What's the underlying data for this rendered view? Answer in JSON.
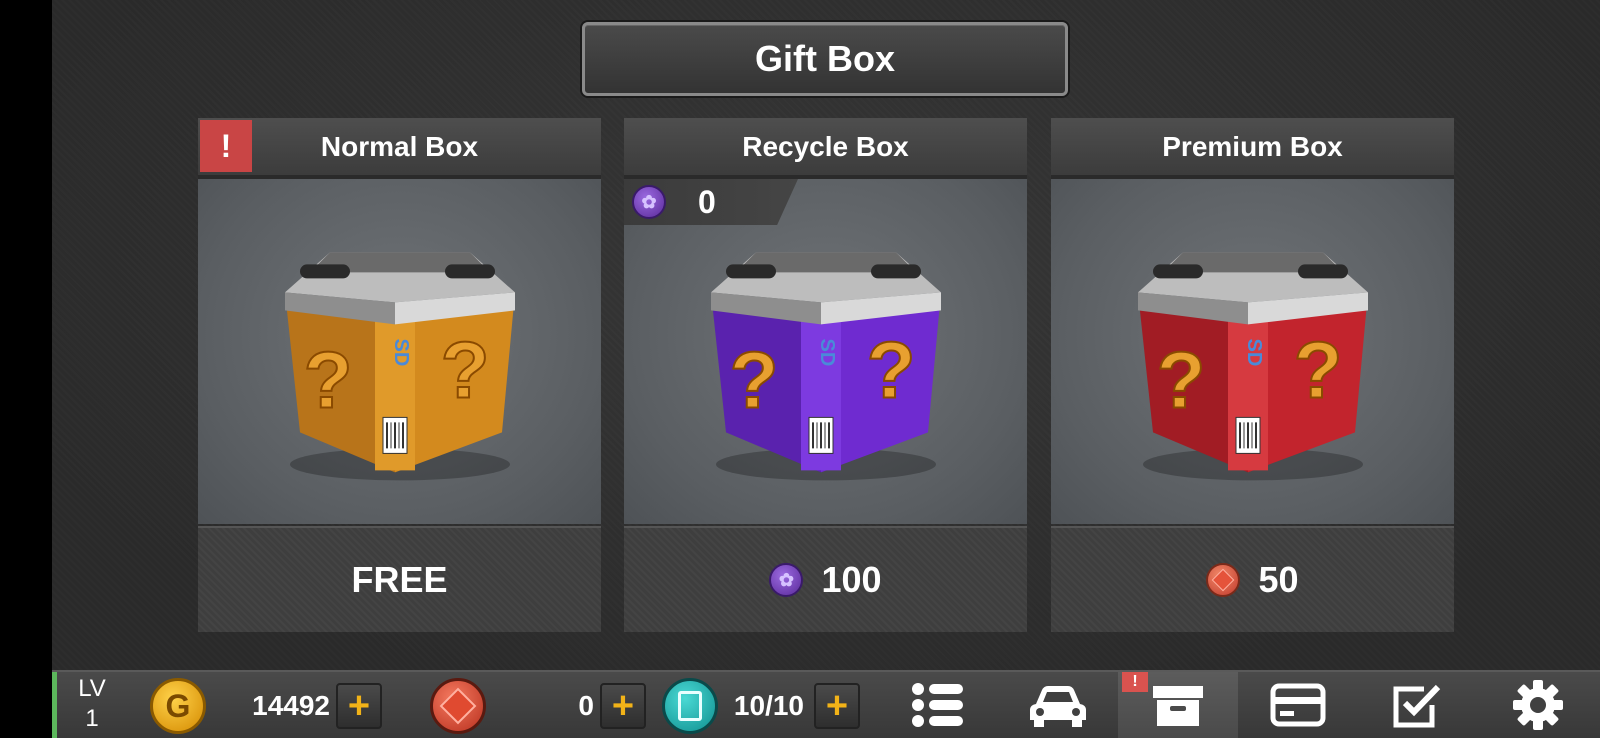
{
  "title": "Gift Box",
  "boxes": [
    {
      "name": "Normal Box",
      "price": "FREE",
      "alert": "!",
      "color": "#d38a1e"
    },
    {
      "name": "Recycle Box",
      "price": "100",
      "counter": "0",
      "color": "#6f2bd0"
    },
    {
      "name": "Premium Box",
      "price": "50",
      "color": "#c2242d"
    }
  ],
  "box_glyphs": {
    "question": "?",
    "brand": "SD"
  },
  "hud": {
    "level_label": "LV",
    "level_value": "1",
    "gold": "14492",
    "ruby": "0",
    "fuel": "10/10",
    "plus": "+",
    "inventory_badge": "!"
  },
  "nav_icons": [
    "list-icon",
    "car-icon",
    "archive-box-icon",
    "card-icon",
    "checkbox-icon",
    "gear-icon"
  ]
}
